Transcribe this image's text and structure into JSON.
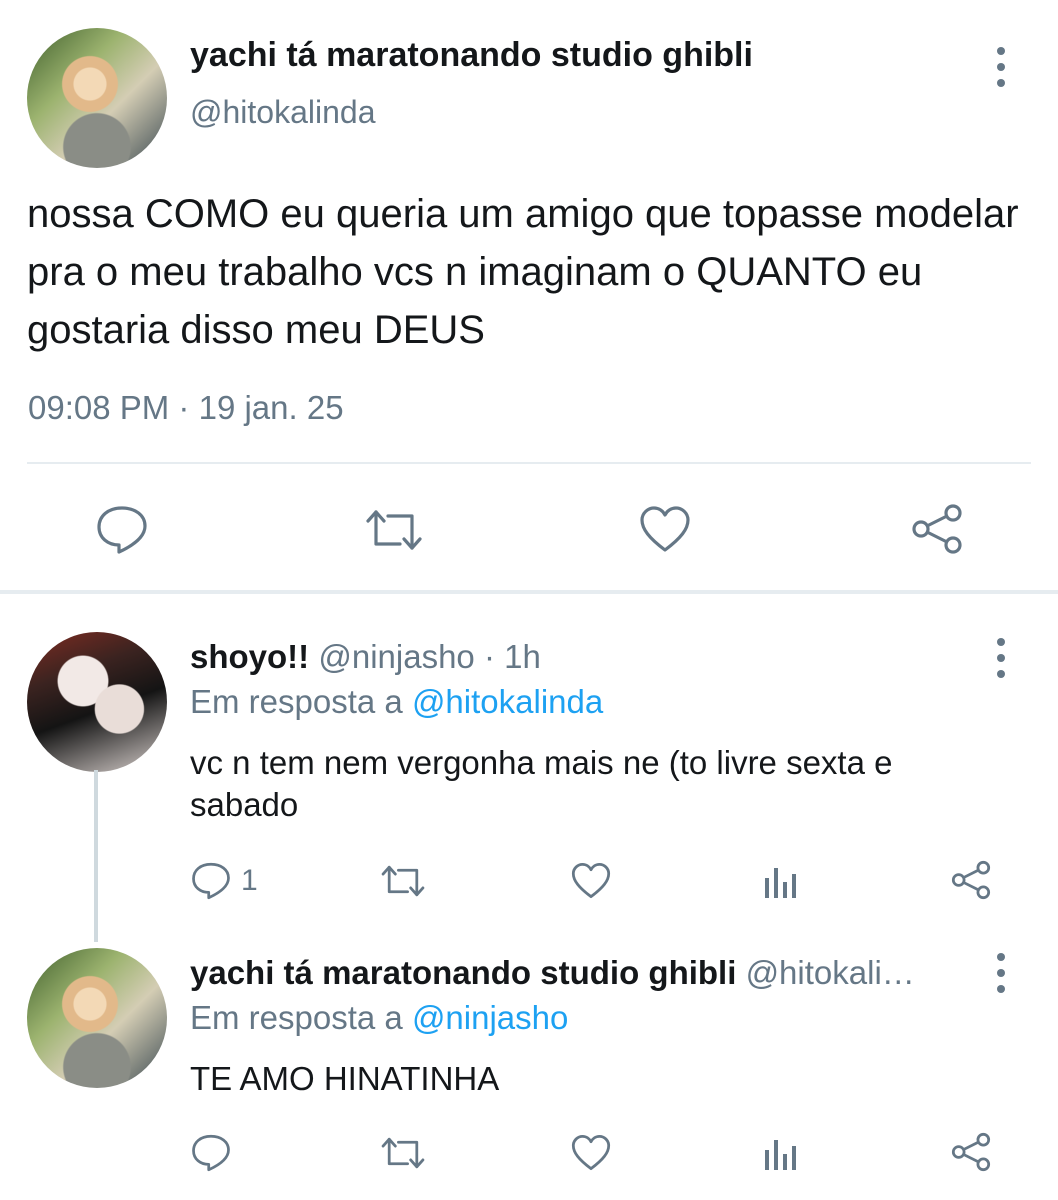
{
  "main_tweet": {
    "display_name": "yachi tá maratonando studio ghibli",
    "handle": "@hitokalinda",
    "text": "nossa COMO eu queria um amigo que topasse modelar pra o meu trabalho vcs n imaginam o QUANTO eu gostaria disso meu DEUS",
    "time": "09:08 PM",
    "date_separator": "·",
    "date": "19 jan. 25"
  },
  "replies": [
    {
      "display_name": "shoyo!!",
      "handle": "@ninjasho",
      "separator": "·",
      "age": "1h",
      "in_reply_prefix": "Em resposta a",
      "in_reply_to": "@hitokalinda",
      "text": "vc n tem nem vergonha mais ne (to livre sexta e sabado",
      "reply_count": "1"
    },
    {
      "display_name": "yachi tá maratonando studio ghibli",
      "handle": "@hitokali…",
      "in_reply_prefix": "Em resposta a",
      "in_reply_to": "@ninjasho",
      "text": "TE AMO HINATINHA"
    }
  ],
  "icons": {
    "reply": "speech-bubble-icon",
    "retweet": "retweet-arrows-icon",
    "like": "heart-icon",
    "share": "share-nodes-icon",
    "analytics": "bar-chart-icon",
    "more": "vertical-ellipsis-icon"
  },
  "colors": {
    "text": "#14171a",
    "muted": "#657786",
    "mention": "#1da1f2",
    "divider": "#e6ecf0"
  }
}
